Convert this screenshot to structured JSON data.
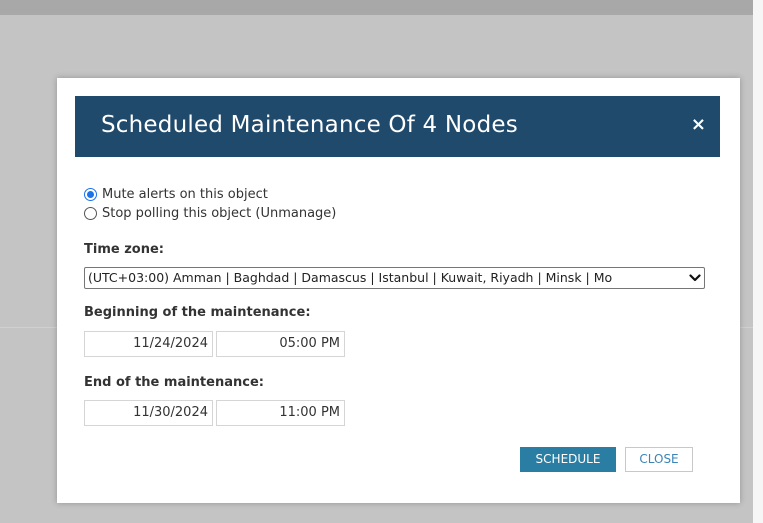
{
  "dialog": {
    "title": "Scheduled Maintenance Of 4 Nodes",
    "close_icon": "×"
  },
  "options": {
    "mute_label": "Mute alerts on this object",
    "unmanage_label": "Stop polling this object (Unmanage)",
    "selected": "mute"
  },
  "timezone": {
    "label": "Time zone:",
    "value": "(UTC+03:00) Amman | Baghdad | Damascus | Istanbul | Kuwait, Riyadh | Minsk | Mo"
  },
  "begin": {
    "label": "Beginning of the maintenance:",
    "date": "11/24/2024",
    "time": "05:00 PM"
  },
  "end": {
    "label": "End of the maintenance:",
    "date": "11/30/2024",
    "time": "11:00 PM"
  },
  "buttons": {
    "schedule": "SCHEDULE",
    "close": "CLOSE"
  },
  "colors": {
    "header": "#204a6b",
    "schedule_button": "#2a7ea3",
    "close_text": "#3a85b7",
    "radio_selected": "#1a73e8"
  }
}
